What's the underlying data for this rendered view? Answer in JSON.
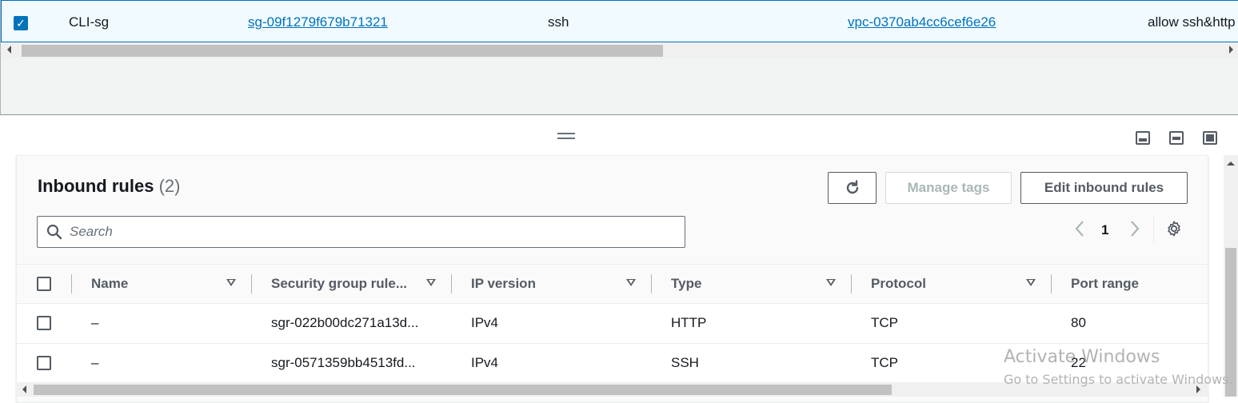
{
  "security_group_row": {
    "name": "CLI-sg",
    "group_id": "sg-09f1279f679b71321",
    "group_name": "ssh",
    "vpc_id": "vpc-0370ab4cc6cef6e26",
    "description": "allow ssh&http",
    "selected": true
  },
  "inbound_rules": {
    "title": "Inbound rules",
    "count": "(2)",
    "buttons": {
      "refresh_icon": "refresh-icon",
      "manage_tags": "Manage tags",
      "edit_inbound_rules": "Edit inbound rules"
    },
    "search": {
      "placeholder": "Search"
    },
    "pagination": {
      "current_page": "1"
    },
    "columns": [
      "Name",
      "Security group rule...",
      "IP version",
      "Type",
      "Protocol",
      "Port range"
    ],
    "rows": [
      {
        "name": "–",
        "rule_id": "sgr-022b00dc271a13d...",
        "ip_version": "IPv4",
        "type": "HTTP",
        "protocol": "TCP",
        "port_range": "80"
      },
      {
        "name": "–",
        "rule_id": "sgr-0571359bb4513fd...",
        "ip_version": "IPv4",
        "type": "SSH",
        "protocol": "TCP",
        "port_range": "22"
      }
    ]
  },
  "watermark": {
    "line1": "Activate Windows",
    "line2": "Go to Settings to activate Windows."
  },
  "colors": {
    "link": "#0073bb",
    "selected_row_bg": "#f1faff",
    "text": "#16191f"
  }
}
